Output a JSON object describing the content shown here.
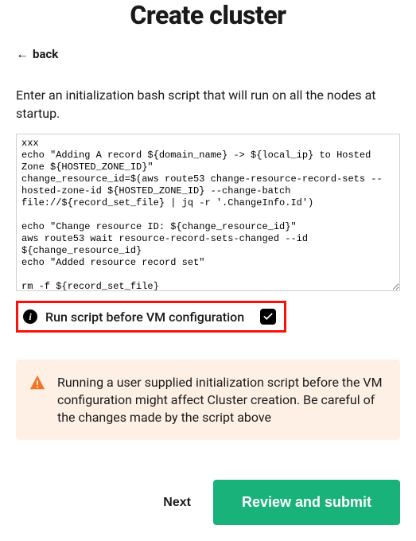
{
  "title": "Create cluster",
  "back_label": "back",
  "description": "Enter an initialization bash script that will run on all the nodes at startup.",
  "script_value": "xxx\necho \"Adding A record ${domain_name} -> ${local_ip} to Hosted Zone ${HOSTED_ZONE_ID}\"\nchange_resource_id=$(aws route53 change-resource-record-sets --hosted-zone-id ${HOSTED_ZONE_ID} --change-batch file://${record_set_file} | jq -r '.ChangeInfo.Id')\n\necho \"Change resource ID: ${change_resource_id}\"\naws route53 wait resource-record-sets-changed --id ${change_resource_id}\necho \"Added resource record set\"\n\nrm -f ${record_set_file}",
  "checkbox": {
    "label": "Run script before VM configuration",
    "checked": true
  },
  "warning_text": "Running a user supplied initialization script before the VM configuration might affect Cluster creation. Be careful of the changes made by the script above",
  "buttons": {
    "next": "Next",
    "review": "Review and submit"
  },
  "colors": {
    "warning_bg": "#fff0e6",
    "warning_icon": "#f37426",
    "highlight_border": "#fc1007",
    "primary_button": "#19b27b"
  }
}
